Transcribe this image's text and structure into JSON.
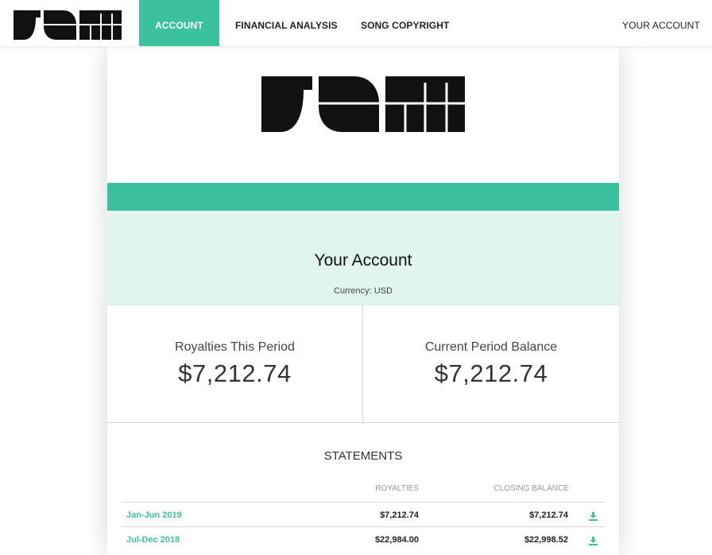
{
  "nav": {
    "logo_name": "vsm-logo",
    "tabs": [
      {
        "label": "ACCOUNT",
        "active": true
      },
      {
        "label": "FINANCIAL ANALYSIS",
        "active": false
      },
      {
        "label": "SONG COPYRIGHT",
        "active": false
      }
    ],
    "your_account": "YOUR ACCOUNT"
  },
  "colors": {
    "accent": "#3cc19f",
    "mint": "#dff5ee"
  },
  "account": {
    "title": "Your Account",
    "currency": "Currency: USD"
  },
  "stats": {
    "royalties_label": "Royalties This Period",
    "royalties_value": "$7,212.74",
    "balance_label": "Current Period Balance",
    "balance_value": "$7,212.74"
  },
  "statements": {
    "title": "STATEMENTS",
    "columns": {
      "royalties": "ROYALTIES",
      "closing": "CLOSING BALANCE"
    },
    "rows": [
      {
        "period": "Jan-Jun 2019",
        "royalties": "$7,212.74",
        "closing": "$7,212.74",
        "icon": "download-icon"
      },
      {
        "period": "Jul-Dec 2018",
        "royalties": "$22,984.00",
        "closing": "$22,998.52",
        "icon": "download-icon"
      }
    ]
  }
}
